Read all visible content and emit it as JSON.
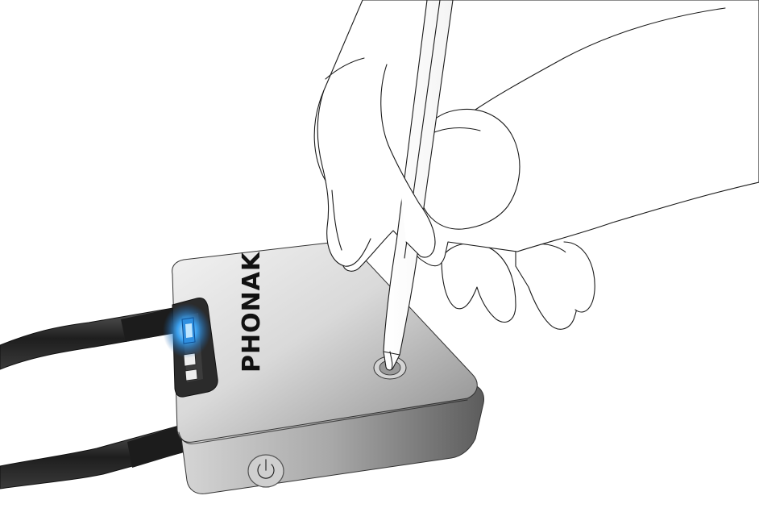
{
  "device": {
    "brand_label": "PHONAK",
    "led_color": "#2f8fe0",
    "body_color_light": "#e9e9e9",
    "body_color_dark": "#6e6e6e",
    "cable_color": "#2a2a2a",
    "power_icon": "power-icon",
    "action": "press-reset-button-with-pen"
  }
}
